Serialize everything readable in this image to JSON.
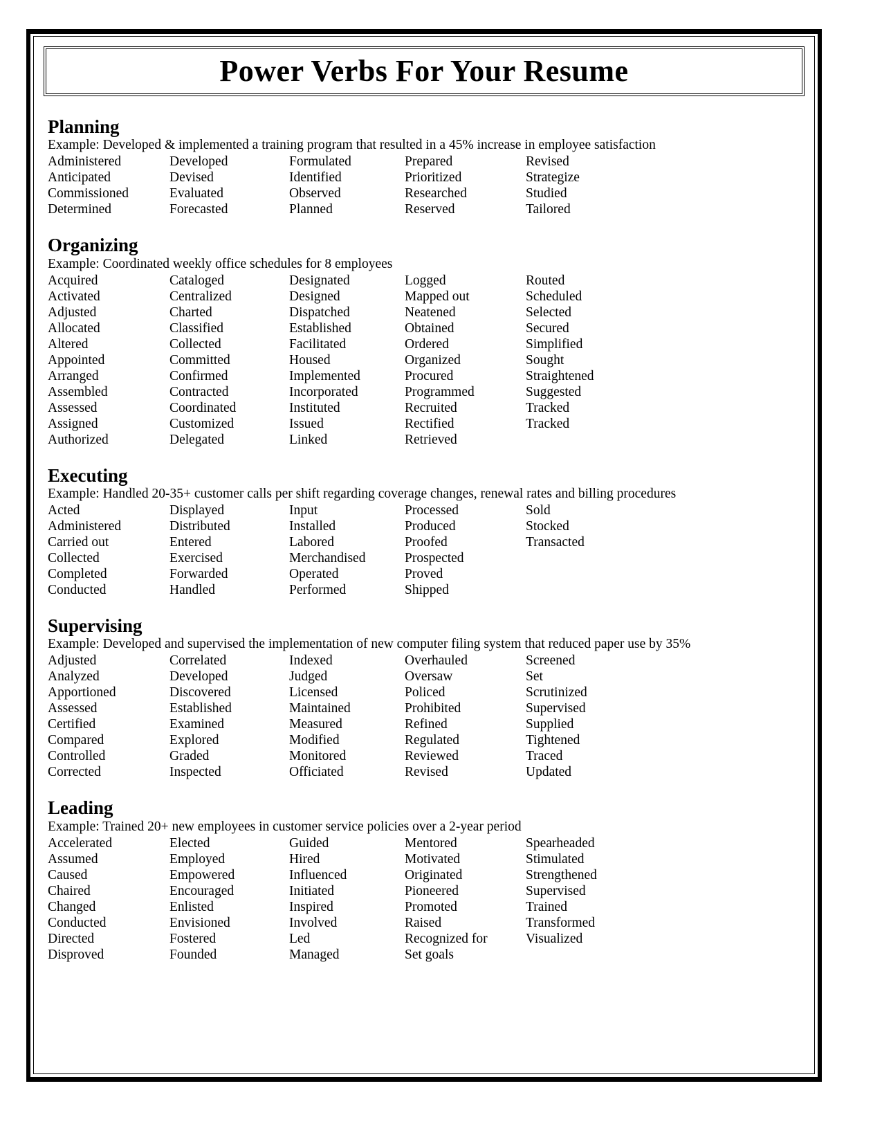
{
  "document": {
    "title": "Power Verbs For Your Resume"
  },
  "sections": [
    {
      "id": "planning",
      "title": "Planning",
      "example": "Example: Developed & implemented a training program that resulted in a 45% increase in employee satisfaction",
      "rows": [
        [
          "Administered",
          "Developed",
          "Formulated",
          "Prepared",
          "Revised"
        ],
        [
          "Anticipated",
          "Devised",
          "Identified",
          "Prioritized",
          "Strategize"
        ],
        [
          "Commissioned",
          "Evaluated",
          "Observed",
          "Researched",
          "Studied"
        ],
        [
          "Determined",
          "Forecasted",
          "Planned",
          "Reserved",
          "Tailored"
        ]
      ]
    },
    {
      "id": "organizing",
      "title": "Organizing",
      "example": "Example: Coordinated weekly office schedules for 8 employees",
      "rows": [
        [
          "Acquired",
          "Cataloged",
          "Designated",
          "Logged",
          "Routed"
        ],
        [
          "Activated",
          "Centralized",
          "Designed",
          "Mapped out",
          "Scheduled"
        ],
        [
          "Adjusted",
          "Charted",
          "Dispatched",
          "Neatened",
          "Selected"
        ],
        [
          "Allocated",
          "Classified",
          "Established",
          "Obtained",
          "Secured"
        ],
        [
          "Altered",
          "Collected",
          "Facilitated",
          "Ordered",
          "Simplified"
        ],
        [
          "Appointed",
          "Committed",
          "Housed",
          "Organized",
          "Sought"
        ],
        [
          "Arranged",
          "Confirmed",
          "Implemented",
          "Procured",
          "Straightened"
        ],
        [
          "Assembled",
          "Contracted",
          "Incorporated",
          "Programmed",
          "Suggested"
        ],
        [
          "Assessed",
          "Coordinated",
          "Instituted",
          "Recruited",
          "Tracked"
        ],
        [
          "Assigned",
          "Customized",
          "Issued",
          "Rectified",
          "Tracked"
        ],
        [
          "Authorized",
          "Delegated",
          "Linked",
          "Retrieved",
          ""
        ]
      ]
    },
    {
      "id": "executing",
      "title": "Executing",
      "example": "Example: Handled 20-35+ customer calls per shift regarding coverage changes, renewal rates and billing procedures",
      "rows": [
        [
          "Acted",
          "Displayed",
          "Input",
          "Processed",
          "Sold"
        ],
        [
          "Administered",
          "Distributed",
          "Installed",
          "Produced",
          "Stocked"
        ],
        [
          "Carried out",
          "Entered",
          "Labored",
          "Proofed",
          "Transacted"
        ],
        [
          "Collected",
          "Exercised",
          "Merchandised",
          "Prospected",
          ""
        ],
        [
          "Completed",
          "Forwarded",
          "Operated",
          "Proved",
          ""
        ],
        [
          "Conducted",
          "Handled",
          "Performed",
          "Shipped",
          ""
        ]
      ]
    },
    {
      "id": "supervising",
      "title": "Supervising",
      "example": "Example: Developed and supervised the implementation of new computer filing system that reduced paper use by 35%",
      "rows": [
        [
          "Adjusted",
          "Correlated",
          "Indexed",
          "Overhauled",
          "Screened"
        ],
        [
          "Analyzed",
          "Developed",
          "Judged",
          "Oversaw",
          "Set"
        ],
        [
          "Apportioned",
          "Discovered",
          "Licensed",
          "Policed",
          "Scrutinized"
        ],
        [
          "Assessed",
          "Established",
          "Maintained",
          "Prohibited",
          "Supervised"
        ],
        [
          "Certified",
          "Examined",
          "Measured",
          "Refined",
          "Supplied"
        ],
        [
          "Compared",
          "Explored",
          "Modified",
          "Regulated",
          "Tightened"
        ],
        [
          "Controlled",
          "Graded",
          "Monitored",
          "Reviewed",
          "Traced"
        ],
        [
          "Corrected",
          "Inspected",
          "Officiated",
          "Revised",
          "Updated"
        ]
      ]
    },
    {
      "id": "leading",
      "title": "Leading",
      "example": "Example: Trained 20+ new employees in customer service policies over a 2-year period",
      "rows": [
        [
          "Accelerated",
          "Elected",
          "Guided",
          "Mentored",
          "Spearheaded"
        ],
        [
          "Assumed",
          "Employed",
          "Hired",
          "Motivated",
          "Stimulated"
        ],
        [
          "Caused",
          "Empowered",
          "Influenced",
          "Originated",
          "Strengthened"
        ],
        [
          "Chaired",
          "Encouraged",
          "Initiated",
          "Pioneered",
          "Supervised"
        ],
        [
          "Changed",
          "Enlisted",
          "Inspired",
          "Promoted",
          "Trained"
        ],
        [
          "Conducted",
          "Envisioned",
          "Involved",
          "Raised",
          "Transformed"
        ],
        [
          "Directed",
          "Fostered",
          "Led",
          "Recognized for",
          "Visualized"
        ],
        [
          "Disproved",
          "Founded",
          "Managed",
          "Set goals",
          ""
        ]
      ]
    }
  ]
}
